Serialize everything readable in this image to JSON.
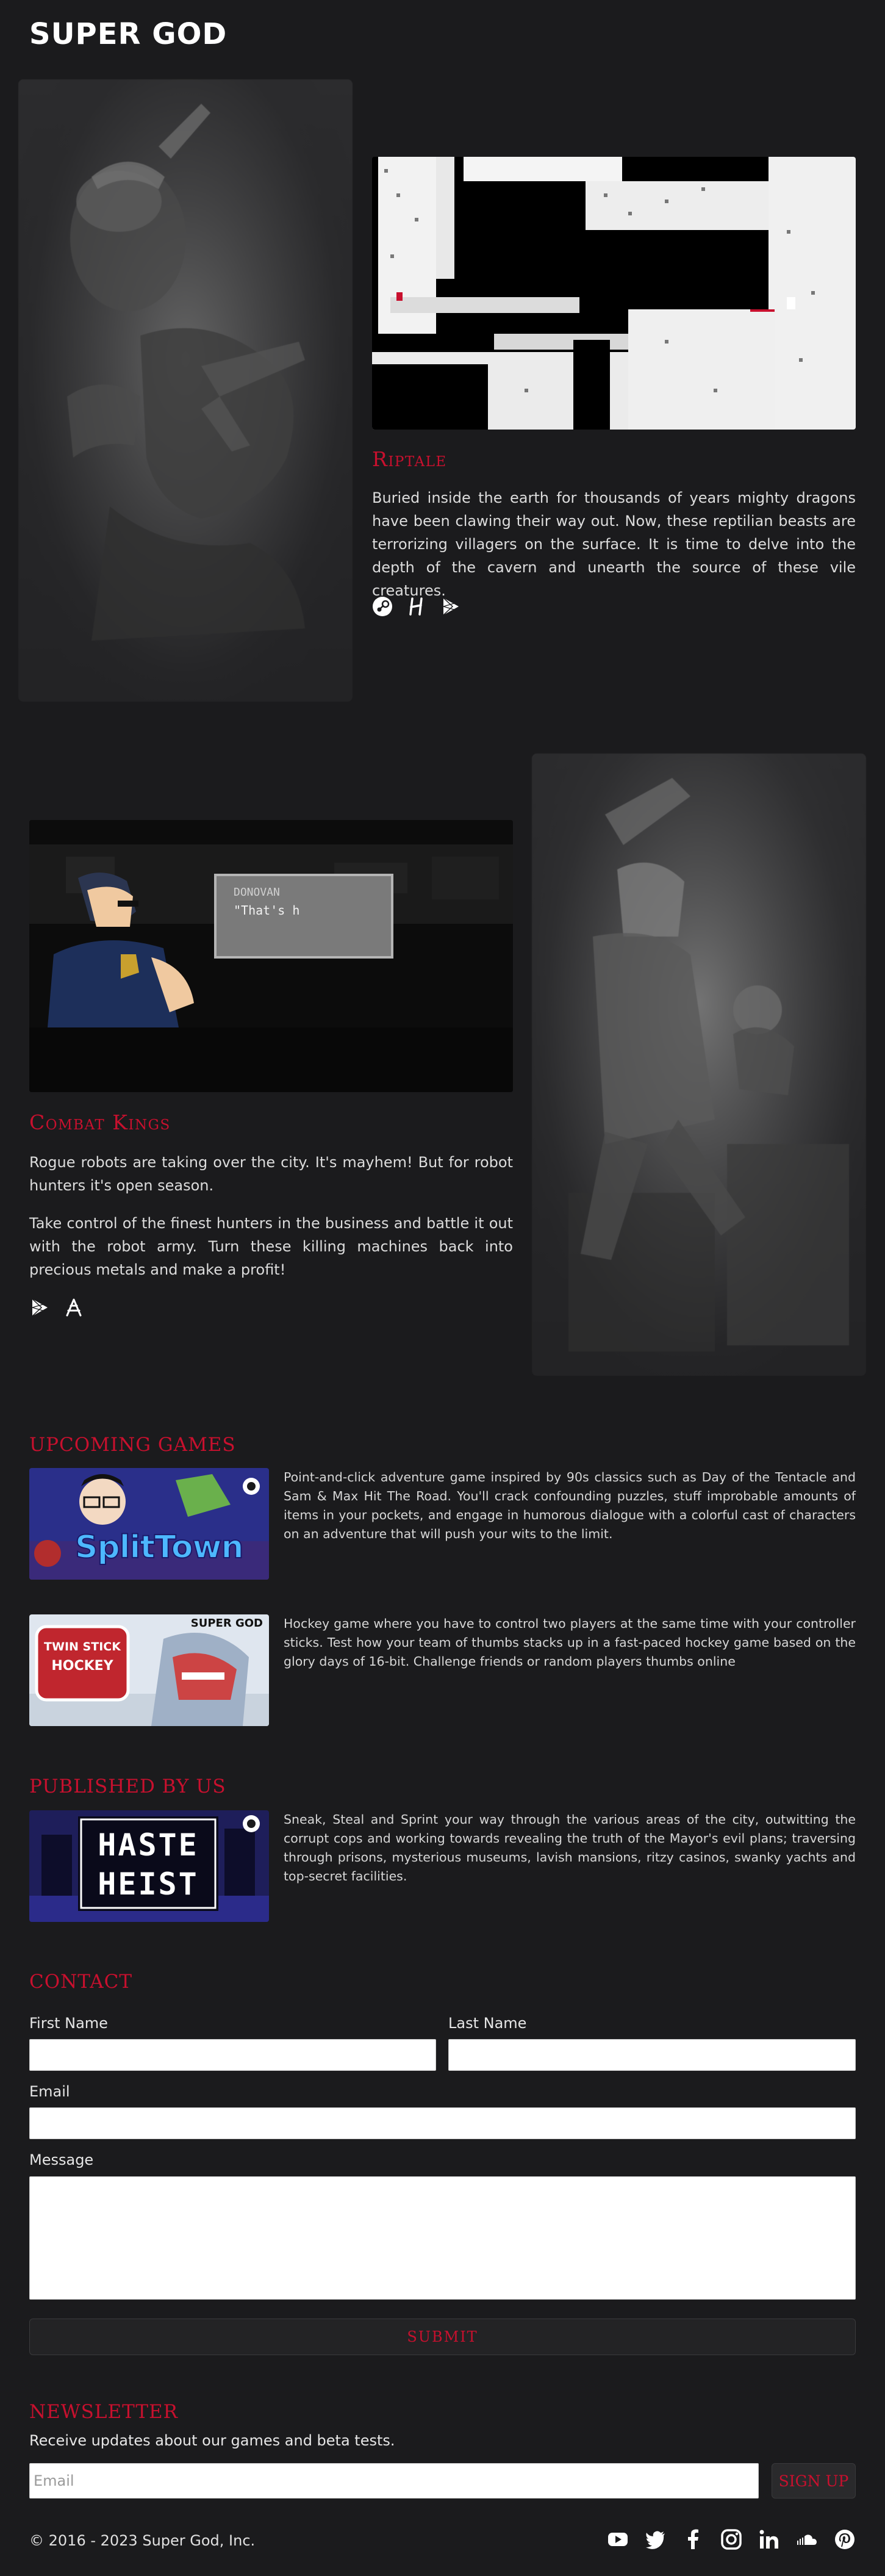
{
  "brand": {
    "logo": "SUPER GOD"
  },
  "featured": [
    {
      "title": "Riptale",
      "description": "Buried inside the earth for thousands of years mighty dragons have been clawing their way out. Now, these reptilian beasts are terrorizing villagers on the surface. It is time to delve into the depth of the cavern and unearth the source of these vile creatures.",
      "store_icons": [
        "steam-icon",
        "humble-bundle-icon",
        "google-play-icon"
      ]
    },
    {
      "title": "Combat Kings",
      "description_1": "Rogue robots are taking over the city. It's mayhem! But for robot hunters it's open season.",
      "description_2": "Take control of the finest hunters in the business and battle it out with the robot army. Turn these killing machines back into precious metals and make a profit!",
      "screenshot_dialog_name": "DONOVAN",
      "screenshot_dialog_text": "\"That's h",
      "store_icons": [
        "google-play-icon",
        "app-store-icon"
      ]
    }
  ],
  "upcoming": {
    "title": "UPCOMING GAMES",
    "items": [
      {
        "thumb_text": "SplitTown",
        "description": "Point-and-click adventure game inspired by 90s classics such as Day of the Tentacle and Sam & Max Hit The Road. You'll crack confounding puzzles, stuff improbable amounts of items in your pockets, and engage in humorous dialogue with a colorful cast of characters on an adventure that will push your wits to the limit."
      },
      {
        "thumb_text_1": "TWIN STICK",
        "thumb_text_2": "HOCKEY",
        "thumb_brand": "SUPER GOD",
        "description": "Hockey game where you have to control two players at the same time with your controller sticks. Test how your team of thumbs stacks up in a fast-paced hockey game based on the glory days of 16-bit. Challenge friends or random players thumbs online"
      }
    ]
  },
  "published": {
    "title": "PUBLISHED BY US",
    "items": [
      {
        "thumb_text_1": "HASTE",
        "thumb_text_2": "HEIST",
        "description": "Sneak, Steal and Sprint your way through the various areas of the city, outwitting the corrupt cops and working towards revealing the truth of the Mayor's evil plans; traversing through prisons, mysterious museums, lavish mansions, ritzy casinos, swanky yachts and top-secret facilities."
      }
    ]
  },
  "contact": {
    "title": "CONTACT",
    "first_name_label": "First Name",
    "last_name_label": "Last Name",
    "email_label": "Email",
    "message_label": "Message",
    "submit_label": "SUBMIT"
  },
  "newsletter": {
    "title": "NEWSLETTER",
    "subtitle": "Receive updates about our games and beta tests.",
    "email_placeholder": "Email",
    "signup_label": "SIGN UP"
  },
  "footer": {
    "copyright": "© 2016 - 2023 Super God, Inc.",
    "social_icons": [
      "youtube-icon",
      "twitter-icon",
      "facebook-icon",
      "instagram-icon",
      "linkedin-icon",
      "soundcloud-icon",
      "pinterest-icon"
    ]
  },
  "colors": {
    "accent": "#c8102e",
    "background": "#1b1b1d"
  }
}
